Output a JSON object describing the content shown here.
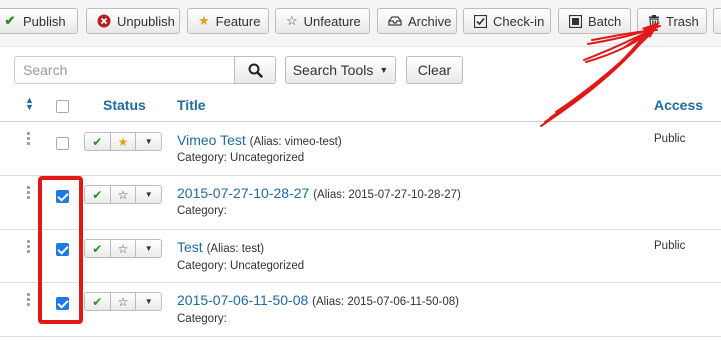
{
  "toolbar": {
    "publish": "Publish",
    "unpublish": "Unpublish",
    "feature": "Feature",
    "unfeature": "Unfeature",
    "archive": "Archive",
    "checkin": "Check-in",
    "batch": "Batch",
    "trash": "Trash"
  },
  "search": {
    "placeholder": "Search",
    "search_tools": "Search Tools",
    "clear": "Clear"
  },
  "columns": {
    "status": "Status",
    "title": "Title",
    "access": "Access"
  },
  "rows": [
    {
      "title": "Vimeo Test",
      "alias": "(Alias: vimeo-test)",
      "category": "Category: Uncategorized",
      "access": "Public",
      "checked": false,
      "featured": true
    },
    {
      "title": "2015-07-27-10-28-27",
      "alias": "(Alias: 2015-07-27-10-28-27)",
      "category": "Category:",
      "access": "",
      "checked": true,
      "featured": false
    },
    {
      "title": "Test",
      "alias": "(Alias: test)",
      "category": "Category: Uncategorized",
      "access": "Public",
      "checked": true,
      "featured": false
    },
    {
      "title": "2015-07-06-11-50-08",
      "alias": "(Alias: 2015-07-06-11-50-08)",
      "category": "Category:",
      "access": "",
      "checked": true,
      "featured": false
    }
  ],
  "colors": {
    "accent": "#1f6b9e",
    "publish_green": "#2c8a2c",
    "unpublish_red": "#b52222",
    "feature_gold": "#e3a21a",
    "annotation_red": "#e01818",
    "checkbox_blue": "#1e7ae4"
  }
}
